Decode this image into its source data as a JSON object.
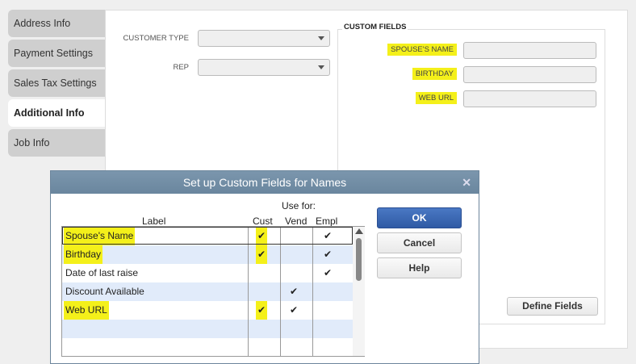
{
  "tabs": [
    {
      "label": "Address Info",
      "active": false
    },
    {
      "label": "Payment Settings",
      "active": false
    },
    {
      "label": "Sales Tax Settings",
      "active": false
    },
    {
      "label": "Additional Info",
      "active": true
    },
    {
      "label": "Job Info",
      "active": false
    }
  ],
  "form": {
    "customer_type_label": "CUSTOMER TYPE",
    "customer_type_value": "",
    "rep_label": "REP",
    "rep_value": ""
  },
  "custom_fields": {
    "title": "CUSTOM FIELDS",
    "fields": [
      {
        "label": "SPOUSE'S NAME",
        "value": ""
      },
      {
        "label": "BIRTHDAY",
        "value": ""
      },
      {
        "label": "WEB URL",
        "value": ""
      }
    ],
    "define_button": "Define Fields"
  },
  "dialog": {
    "title": "Set up Custom Fields for Names",
    "close": "✕",
    "use_for": "Use for:",
    "columns": [
      "Label",
      "Cust",
      "Vend",
      "Empl"
    ],
    "rows": [
      {
        "label": "Spouse's Name",
        "cust": "✔",
        "vend": "",
        "empl": "✔",
        "highlight": true
      },
      {
        "label": "Birthday",
        "cust": "✔",
        "vend": "",
        "empl": "✔",
        "highlight": true
      },
      {
        "label": "Date of last raise",
        "cust": "",
        "vend": "",
        "empl": "✔",
        "highlight": false
      },
      {
        "label": "Discount Available",
        "cust": "",
        "vend": "✔",
        "empl": "",
        "highlight": false
      },
      {
        "label": "Web URL",
        "cust": "✔",
        "vend": "✔",
        "empl": "",
        "highlight": true
      },
      {
        "label": "",
        "cust": "",
        "vend": "",
        "empl": "",
        "highlight": false
      },
      {
        "label": "",
        "cust": "",
        "vend": "",
        "empl": "",
        "highlight": false
      }
    ],
    "buttons": {
      "ok": "OK",
      "cancel": "Cancel",
      "help": "Help"
    }
  },
  "colors": {
    "highlight": "#f4f01a",
    "ok_button": "#3c66b0",
    "title_bar": "#7290a8"
  }
}
